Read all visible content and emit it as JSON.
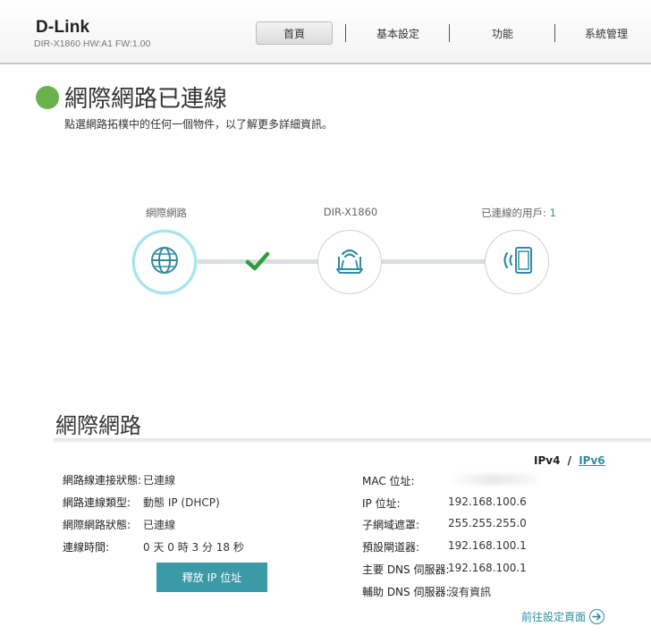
{
  "header": {
    "brand": "D-Link",
    "model_info": "DIR-X1860 HW:A1 FW:1.00",
    "nav": [
      {
        "label": "首頁",
        "active": true
      },
      {
        "label": "基本設定",
        "active": false
      },
      {
        "label": "功能",
        "active": false
      },
      {
        "label": "系統管理",
        "active": false
      }
    ]
  },
  "status": {
    "color": "#6ab04c",
    "title": "網際網路已連線",
    "subtitle": "點選網路拓樸中的任何一個物件，以了解更多詳細資訊。"
  },
  "topology": {
    "internet_label": "網際網路",
    "router_label": "DIR-X1860",
    "clients_label": "已連線的用戶:",
    "clients_count": "1",
    "internet_icon": "globe-icon",
    "router_icon": "router-icon",
    "client_icon": "tablet-icon",
    "link_status_icon": "check-icon"
  },
  "internet_section": {
    "title": "網際網路",
    "ipv4_label": "IPv4",
    "separator": "/",
    "ipv6_label": "IPv6",
    "left_rows": [
      {
        "label": "網路線連接狀態:",
        "value": "已連線"
      },
      {
        "label": "網路連線類型:",
        "value": "動態 IP (DHCP)"
      },
      {
        "label": "網際網路狀態:",
        "value": "已連線"
      },
      {
        "label": "連線時間:",
        "value": "0 天 0 時 3 分 18 秒"
      }
    ],
    "right_rows": [
      {
        "label": "MAC 位址:",
        "value": ""
      },
      {
        "label": "IP 位址:",
        "value": "192.168.100.6"
      },
      {
        "label": "子網域遮罩:",
        "value": "255.255.255.0"
      },
      {
        "label": "預設閘道器:",
        "value": "192.168.100.1"
      },
      {
        "label": "主要 DNS 伺服器:",
        "value": "192.168.100.1"
      },
      {
        "label": "輔助 DNS 伺服器:",
        "value": "沒有資訊"
      }
    ],
    "release_button": "釋放 IP 位址",
    "goto_link": "前往設定頁面"
  },
  "colors": {
    "accent": "#3b9aa6",
    "link": "#2e8da0",
    "check": "#2e9e3e",
    "selected_ring": "#a7e4ec"
  }
}
